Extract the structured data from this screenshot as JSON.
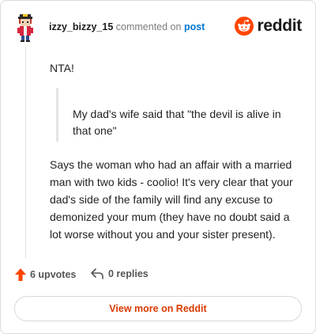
{
  "header": {
    "username": "izzy_bizzy_15",
    "action_text": " commented on ",
    "post_link": "post",
    "brand_name": "reddit"
  },
  "comment": {
    "opening": "NTA!",
    "quote": "My dad's wife said that \"the devil is alive in that one\"",
    "body": "Says the woman who had an affair with a married man with two kids - coolio! It's very clear that your dad's side of the family will find any excuse to demonized your mum (they have no doubt said a lot worse without you and your sister present)."
  },
  "footer": {
    "upvotes": "6 upvotes",
    "replies": "0 replies"
  },
  "cta": {
    "label": "View more on Reddit"
  },
  "colors": {
    "brand_orange": "#ff4500",
    "link_blue": "#0079d3",
    "cta_text": "#d93a00"
  },
  "icons": [
    "user-avatar",
    "reddit-snoo-icon",
    "upvote-arrow-icon",
    "reply-arrow-icon"
  ]
}
